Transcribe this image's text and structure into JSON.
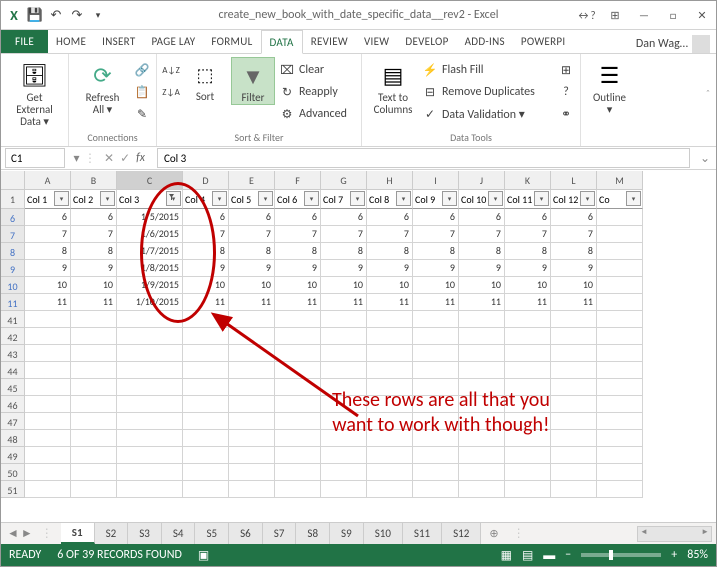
{
  "title": "create_new_book_with_date_specific_data__rev2 - Excel",
  "user": "Dan Wag…",
  "tabs": [
    "FILE",
    "HOME",
    "INSERT",
    "PAGE LAY",
    "FORMUL",
    "DATA",
    "REVIEW",
    "VIEW",
    "DEVELOP",
    "ADD-INS",
    "POWERPI"
  ],
  "activeTab": "DATA",
  "ribbon": {
    "getData": "Get External\nData ▾",
    "refresh": "Refresh\nAll ▾",
    "connGrp": "Connections",
    "sort": "Sort",
    "filter": "Filter",
    "clear": "Clear",
    "reapply": "Reapply",
    "advanced": "Advanced",
    "sortGrp": "Sort & Filter",
    "t2c": "Text to\nColumns",
    "flash": "Flash Fill",
    "dupes": "Remove Duplicates",
    "valid": "Data Validation ▾",
    "toolsGrp": "Data Tools",
    "outline": "Outline\n▾"
  },
  "nameBox": "C1",
  "fxValue": "Col 3",
  "cols": [
    "A",
    "B",
    "C",
    "D",
    "E",
    "F",
    "G",
    "H",
    "I",
    "J",
    "K",
    "L",
    "M"
  ],
  "selCol": "C",
  "headers": [
    "Col 1",
    "Col 2",
    "Col 3",
    "Col 4",
    "Col 5",
    "Col 6",
    "Col 7",
    "Col 8",
    "Col 9",
    "Col 10",
    "Col 11",
    "Col 12",
    "Co"
  ],
  "rows": [
    {
      "n": 6,
      "v": [
        6,
        6,
        "1/5/2015",
        6,
        6,
        6,
        6,
        6,
        6,
        6,
        6,
        6,
        ""
      ]
    },
    {
      "n": 7,
      "v": [
        7,
        7,
        "1/6/2015",
        7,
        7,
        7,
        7,
        7,
        7,
        7,
        7,
        7,
        ""
      ]
    },
    {
      "n": 8,
      "v": [
        8,
        8,
        "1/7/2015",
        8,
        8,
        8,
        8,
        8,
        8,
        8,
        8,
        8,
        ""
      ]
    },
    {
      "n": 9,
      "v": [
        9,
        9,
        "1/8/2015",
        9,
        9,
        9,
        9,
        9,
        9,
        9,
        9,
        9,
        ""
      ]
    },
    {
      "n": 10,
      "v": [
        10,
        10,
        "1/9/2015",
        10,
        10,
        10,
        10,
        10,
        10,
        10,
        10,
        10,
        ""
      ]
    },
    {
      "n": 11,
      "v": [
        11,
        11,
        "1/10/2015",
        11,
        11,
        11,
        11,
        11,
        11,
        11,
        11,
        11,
        ""
      ]
    }
  ],
  "emptyRows": [
    41,
    42,
    43,
    44,
    45,
    46,
    47,
    48,
    49,
    50,
    51
  ],
  "sheets": [
    "S1",
    "S2",
    "S3",
    "S4",
    "S5",
    "S6",
    "S7",
    "S8",
    "S9",
    "S10",
    "S11",
    "S12"
  ],
  "activeSheet": "S1",
  "status": {
    "ready": "READY",
    "found": "6 OF 39 RECORDS FOUND",
    "zoom": "85%"
  },
  "annotation": "These rows are all that you\nwant to work with though!"
}
